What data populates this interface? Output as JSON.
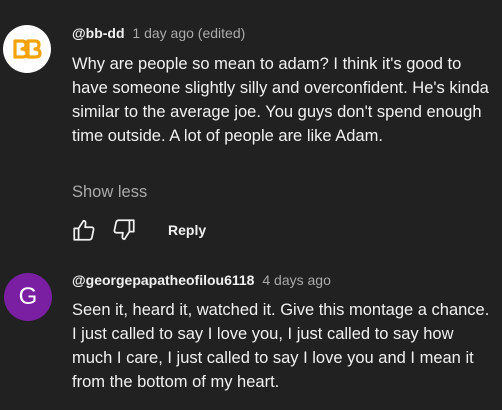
{
  "comments": [
    {
      "avatar_icon": "bb-dd-logo-avatar",
      "author": "@bb-dd",
      "time": "1 day ago (edited)",
      "text": "Why are people so mean to adam? I think it's good to have someone slightly silly and overconfident. He's kinda similar to the average joe. You guys don't spend enough time outside. A lot of people are like Adam.",
      "show_less_label": "Show less",
      "reply_label": "Reply",
      "like_icon": "thumbs-up-icon",
      "dislike_icon": "thumbs-down-icon",
      "logo_color": "#f5a30a"
    },
    {
      "avatar_initial": "G",
      "avatar_color": "#7b1fa2",
      "author": "@georgepapatheofilou6118",
      "time": "4 days ago",
      "text": "Seen it, heard it, watched it. Give this montage a chance. I just called to say I love you, I just called to say how much I care, I just called to say I love you and I mean it from the bottom of my heart."
    }
  ],
  "colors": {
    "background": "#212121",
    "text_primary": "#f1f1f1",
    "text_secondary": "#aaaaaa"
  }
}
